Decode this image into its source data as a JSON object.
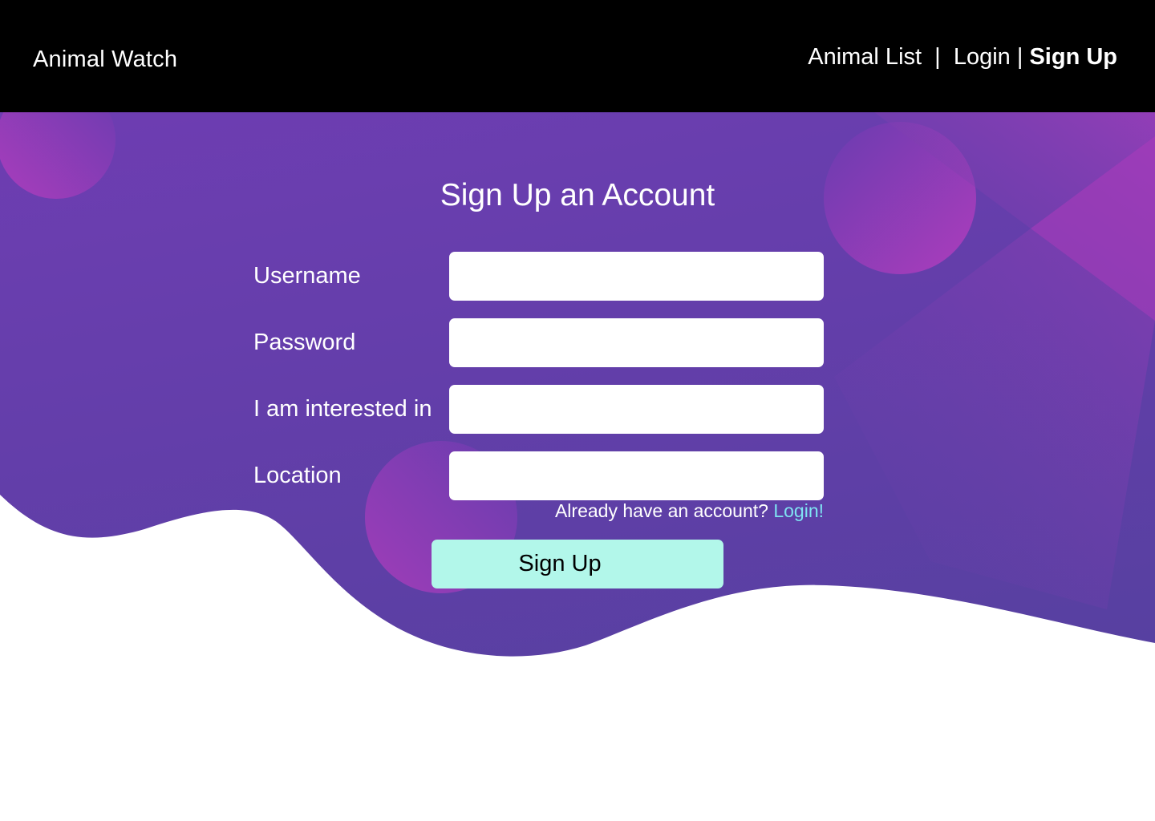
{
  "header": {
    "brand": "Animal Watch",
    "nav": {
      "animal_list": "Animal List",
      "separator_1": "  |  ",
      "login": "Login",
      "separator_2": " | ",
      "sign_up": "Sign Up"
    }
  },
  "main": {
    "title": "Sign Up an Account",
    "fields": {
      "username": {
        "label": "Username",
        "value": ""
      },
      "password": {
        "label": "Password",
        "value": ""
      },
      "interest": {
        "label": "I am interested in",
        "value": ""
      },
      "location": {
        "label": "Location",
        "value": ""
      }
    },
    "have_account_text": "Already have an account? ",
    "login_link": "Login!",
    "submit_label": "Sign Up"
  },
  "colors": {
    "header_bg": "#000000",
    "hero_top": "#6b3ab0",
    "hero_bottom": "#5840a0",
    "accent_shape": "#b03dbd",
    "button_bg": "#b2f7ea",
    "link": "#7fe3f2"
  }
}
